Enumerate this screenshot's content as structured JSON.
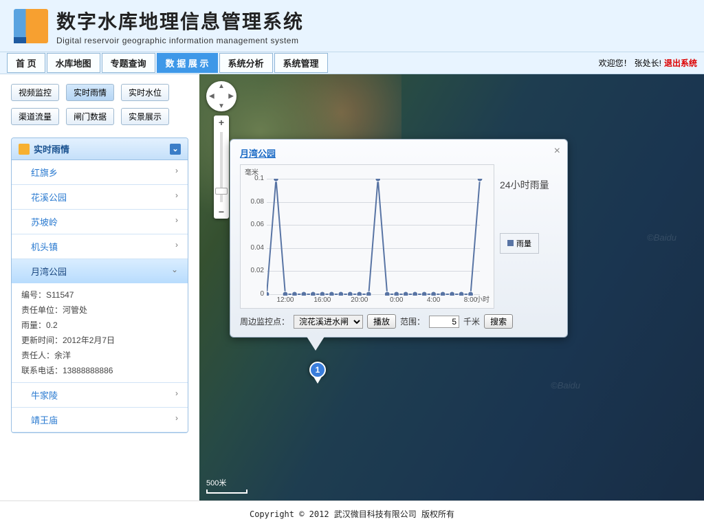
{
  "header": {
    "title_cn": "数字水库地理信息管理系统",
    "title_en": "Digital reservoir geographic information management system"
  },
  "nav": {
    "tabs": [
      "首 页",
      "水库地图",
      "专题查询",
      "数 据 展 示",
      "系统分析",
      "系统管理"
    ],
    "active": 3,
    "welcome": "欢迎您！",
    "user": "张处长!",
    "logout": "退出系统"
  },
  "subtabs": {
    "items": [
      "视频监控",
      "实时雨情",
      "实时水位",
      "渠道流量",
      "闸门数据",
      "实景展示"
    ],
    "active": 1
  },
  "panel": {
    "title": "实时雨情"
  },
  "accordion": {
    "items": [
      {
        "label": "红旗乡"
      },
      {
        "label": "花溪公园"
      },
      {
        "label": "苏坡岭"
      },
      {
        "label": "机头镇"
      },
      {
        "label": "月湾公园",
        "selected": true,
        "detail": {
          "id": "编号：S11547",
          "unit": "责任单位：河管处",
          "rain": "雨量：0.2",
          "updated": "更新时间：2012年2月7日",
          "person": "责任人：余洋",
          "phone": "联系电话：13888888886"
        }
      },
      {
        "label": "牛家陵"
      },
      {
        "label": "靖王庙"
      }
    ]
  },
  "popup": {
    "title": "月湾公园",
    "side_label": "24小时雨量",
    "legend": "雨量",
    "monitor_label": "周边监控点：",
    "monitor_select": "浣花溪进水闸",
    "play": "播放",
    "range_label": "范围：",
    "range_value": "5",
    "range_unit": "千米",
    "search": "搜索"
  },
  "chart_data": {
    "type": "line",
    "title": "月湾公园",
    "ylabel": "毫米",
    "xlabel": "小时",
    "ylim": [
      0,
      0.1
    ],
    "yticks": [
      0,
      0.02,
      0.04,
      0.06,
      0.08,
      0.1
    ],
    "x": [
      "10:00",
      "11:00",
      "12:00",
      "13:00",
      "14:00",
      "15:00",
      "16:00",
      "17:00",
      "18:00",
      "19:00",
      "20:00",
      "21:00",
      "22:00",
      "23:00",
      "0:00",
      "1:00",
      "2:00",
      "3:00",
      "4:00",
      "5:00",
      "6:00",
      "7:00",
      "8:00",
      "9:00"
    ],
    "xticks_shown": [
      "12:00",
      "16:00",
      "20:00",
      "0:00",
      "4:00",
      "8:00"
    ],
    "series": [
      {
        "name": "雨量",
        "values": [
          0,
          0.1,
          0,
          0,
          0,
          0,
          0,
          0,
          0,
          0,
          0,
          0,
          0.1,
          0,
          0,
          0,
          0,
          0,
          0,
          0,
          0,
          0,
          0,
          0.1
        ]
      }
    ]
  },
  "map": {
    "scale": "500米",
    "marker": "1",
    "watermark": "©Baidu"
  },
  "footer": "Copyright © 2012 武汉微目科技有限公司  版权所有"
}
